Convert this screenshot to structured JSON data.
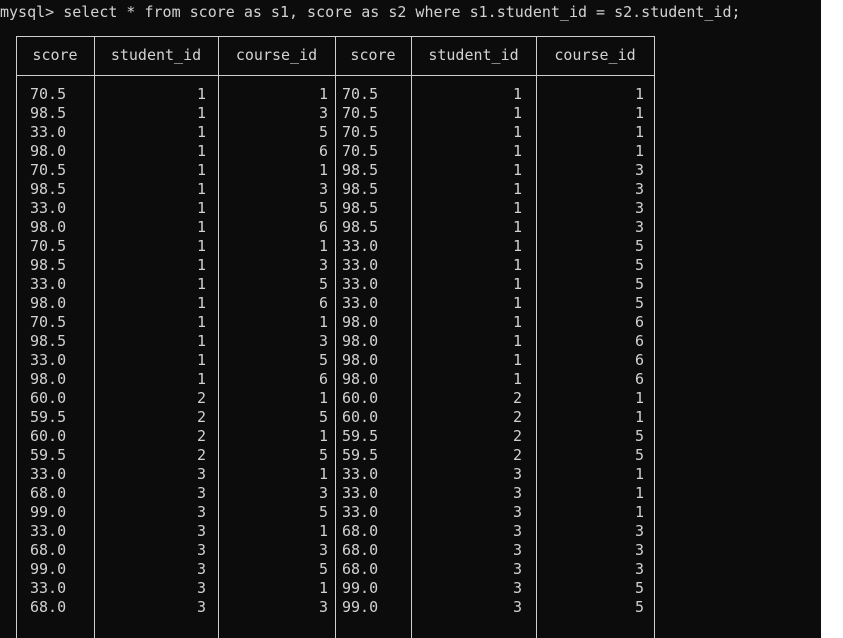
{
  "prompt": "mysql> select * from score as s1, score as s2 where s1.student_id = s2.student_id;",
  "columns": [
    "score",
    "student_id",
    "course_id",
    "score",
    "student_id",
    "course_id"
  ],
  "rows": [
    [
      "70.5",
      "1",
      "1",
      "70.5",
      "1",
      "1"
    ],
    [
      "98.5",
      "1",
      "3",
      "70.5",
      "1",
      "1"
    ],
    [
      "33.0",
      "1",
      "5",
      "70.5",
      "1",
      "1"
    ],
    [
      "98.0",
      "1",
      "6",
      "70.5",
      "1",
      "1"
    ],
    [
      "70.5",
      "1",
      "1",
      "98.5",
      "1",
      "3"
    ],
    [
      "98.5",
      "1",
      "3",
      "98.5",
      "1",
      "3"
    ],
    [
      "33.0",
      "1",
      "5",
      "98.5",
      "1",
      "3"
    ],
    [
      "98.0",
      "1",
      "6",
      "98.5",
      "1",
      "3"
    ],
    [
      "70.5",
      "1",
      "1",
      "33.0",
      "1",
      "5"
    ],
    [
      "98.5",
      "1",
      "3",
      "33.0",
      "1",
      "5"
    ],
    [
      "33.0",
      "1",
      "5",
      "33.0",
      "1",
      "5"
    ],
    [
      "98.0",
      "1",
      "6",
      "33.0",
      "1",
      "5"
    ],
    [
      "70.5",
      "1",
      "1",
      "98.0",
      "1",
      "6"
    ],
    [
      "98.5",
      "1",
      "3",
      "98.0",
      "1",
      "6"
    ],
    [
      "33.0",
      "1",
      "5",
      "98.0",
      "1",
      "6"
    ],
    [
      "98.0",
      "1",
      "6",
      "98.0",
      "1",
      "6"
    ],
    [
      "60.0",
      "2",
      "1",
      "60.0",
      "2",
      "1"
    ],
    [
      "59.5",
      "2",
      "5",
      "60.0",
      "2",
      "1"
    ],
    [
      "60.0",
      "2",
      "1",
      "59.5",
      "2",
      "5"
    ],
    [
      "59.5",
      "2",
      "5",
      "59.5",
      "2",
      "5"
    ],
    [
      "33.0",
      "3",
      "1",
      "33.0",
      "3",
      "1"
    ],
    [
      "68.0",
      "3",
      "3",
      "33.0",
      "3",
      "1"
    ],
    [
      "99.0",
      "3",
      "5",
      "33.0",
      "3",
      "1"
    ],
    [
      "33.0",
      "3",
      "1",
      "68.0",
      "3",
      "3"
    ],
    [
      "68.0",
      "3",
      "3",
      "68.0",
      "3",
      "3"
    ],
    [
      "99.0",
      "3",
      "5",
      "68.0",
      "3",
      "3"
    ],
    [
      "33.0",
      "3",
      "1",
      "99.0",
      "3",
      "5"
    ],
    [
      "68.0",
      "3",
      "3",
      "99.0",
      "3",
      "5"
    ]
  ]
}
